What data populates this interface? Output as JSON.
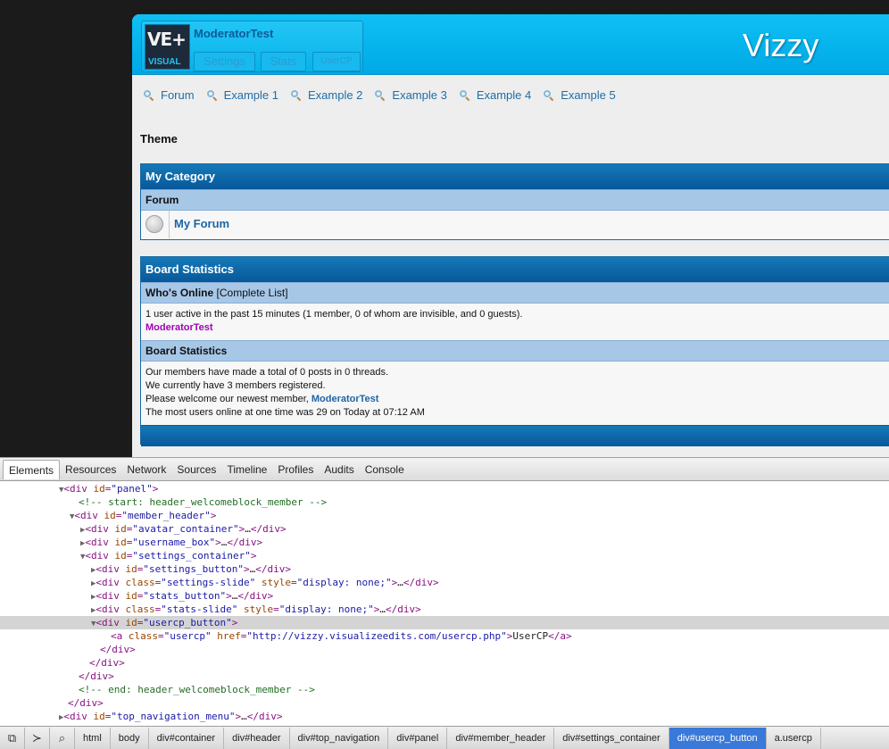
{
  "site": {
    "logo": {
      "top": "VE+",
      "bottom": "VISUAL"
    },
    "username": "ModeratorTest",
    "buttons": {
      "settings": "Settings",
      "stats": "Stats",
      "usercp": "UserCP"
    },
    "title": "Vizzy",
    "nav": [
      "Forum",
      "Example 1",
      "Example 2",
      "Example 3",
      "Example 4",
      "Example 5"
    ],
    "theme_label": "Theme",
    "category": {
      "title": "My Category",
      "column": "Forum",
      "forum_name": "My Forum"
    },
    "board_stats": {
      "title": "Board Statistics",
      "whos_online_label": "Who's Online",
      "complete_list": "[Complete List]",
      "online_text": "1 user active in the past 15 minutes (1 member, 0 of whom are invisible, and 0 guests).",
      "online_user": "ModeratorTest",
      "stats_header": "Board Statistics",
      "line1": "Our members have made a total of 0 posts in 0 threads.",
      "line2": "We currently have 3 members registered.",
      "line3_prefix": "Please welcome our newest member,",
      "newest_member": "ModeratorTest",
      "line4": "The most users online at one time was 29 on Today at 07:12 AM"
    }
  },
  "devtools": {
    "tabs": [
      "Elements",
      "Resources",
      "Network",
      "Sources",
      "Timeline",
      "Profiles",
      "Audits",
      "Console"
    ],
    "active_tab": "Elements",
    "breadcrumbs": [
      "html",
      "body",
      "div#container",
      "div#header",
      "div#top_navigation",
      "div#panel",
      "div#member_header",
      "div#settings_container",
      "div#usercp_button",
      "a.usercp"
    ],
    "active_crumb": "div#usercp_button"
  }
}
